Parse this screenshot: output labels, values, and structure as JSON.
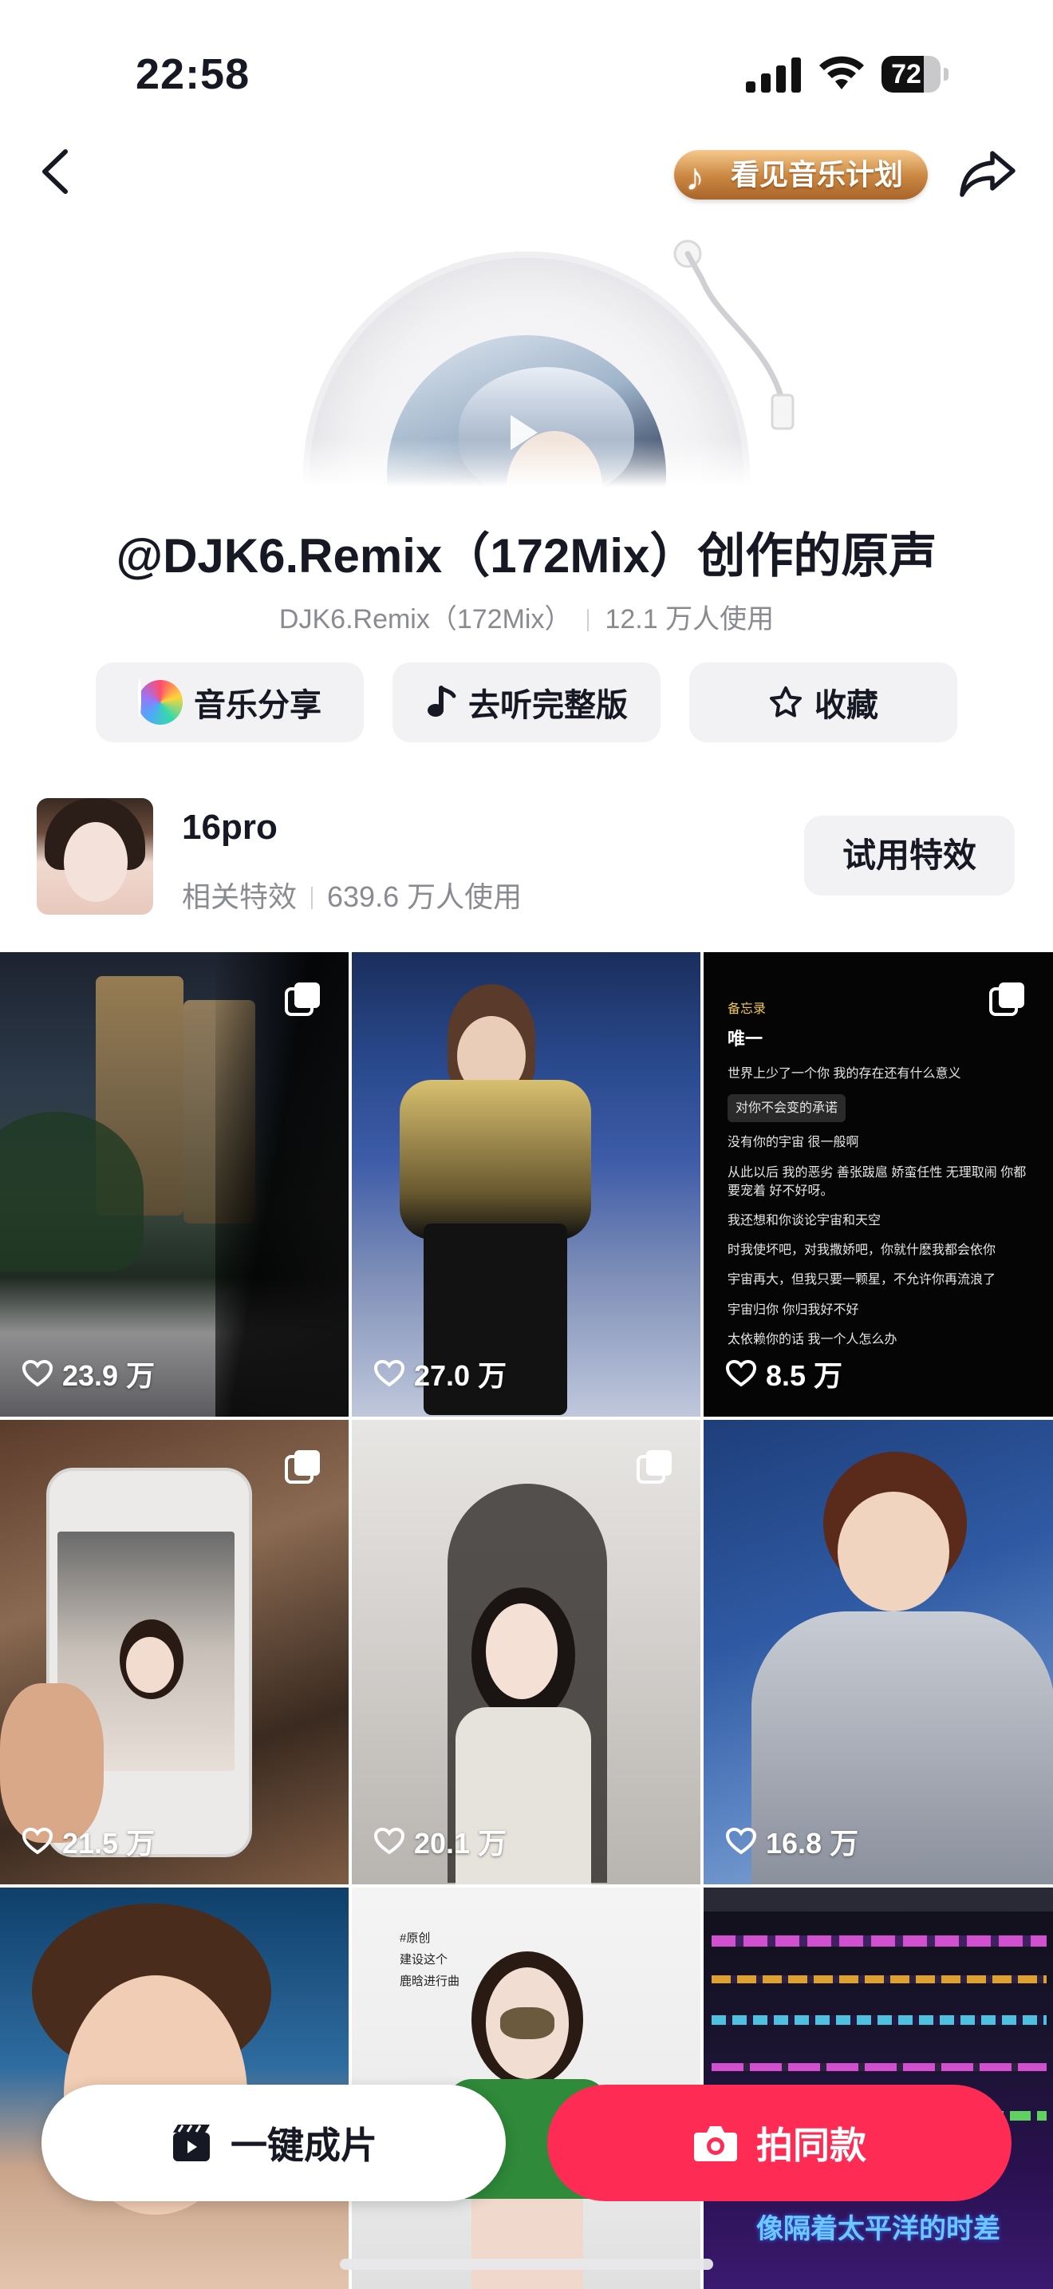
{
  "status_bar": {
    "time": "22:58",
    "battery": "72",
    "battery_level": 0.72
  },
  "header": {
    "promo_label": "看见音乐计划"
  },
  "title": "@DJK6.Remix（172Mix）创作的原声",
  "meta": {
    "author": "DJK6.Remix（172Mix）",
    "usage": "12.1 万人使用"
  },
  "actions": {
    "share": "音乐分享",
    "full_version": "去听完整版",
    "favorite": "收藏"
  },
  "effect": {
    "name": "16pro",
    "label": "相关特效",
    "usage": "639.6 万人使用",
    "try_button": "试用特效"
  },
  "videos": [
    {
      "likes": "23.9 万",
      "multi": true
    },
    {
      "likes": "27.0 万",
      "multi": false
    },
    {
      "likes": "8.5 万",
      "multi": true
    },
    {
      "likes": "21.5 万",
      "multi": true
    },
    {
      "likes": "20.1 万",
      "multi": true
    },
    {
      "likes": "16.8 万",
      "multi": false
    },
    {
      "likes": "",
      "multi": false
    },
    {
      "likes": "",
      "multi": false
    },
    {
      "likes": "",
      "multi": false
    }
  ],
  "notes_screenshot": {
    "back": "备忘录",
    "heading": "唯一",
    "lines": [
      "世界上少了一个你 我的存在还有什么意义",
      "对你不会变的承诺",
      "没有你的宇宙 很一般啊",
      "从此以后 我的恶劣 善张跋扈 娇蛮任性 无理取闹 你都要宠着 好不好呀。",
      "我还想和你谈论宇宙和天空",
      "时我使坏吧，对我撒娇吧，你就什麽我都会依你",
      "宇宙再大，但我只要一颗星，不允许你再流浪了",
      "宇宙归你 你归我好不好",
      "太依赖你的话 我一个人怎么办"
    ]
  },
  "tile8_text": {
    "tag": "#原创",
    "line1": "建设这个",
    "line2": "鹿晗进行曲"
  },
  "tile9_text": {
    "caption": "像隔着太平洋的时差"
  },
  "bottom": {
    "one_click": "一键成片",
    "shoot_same": "拍同款"
  },
  "colors": {
    "accent": "#fe2c55",
    "pill_bg": "#f2f2f4",
    "muted": "#8a8b91"
  }
}
